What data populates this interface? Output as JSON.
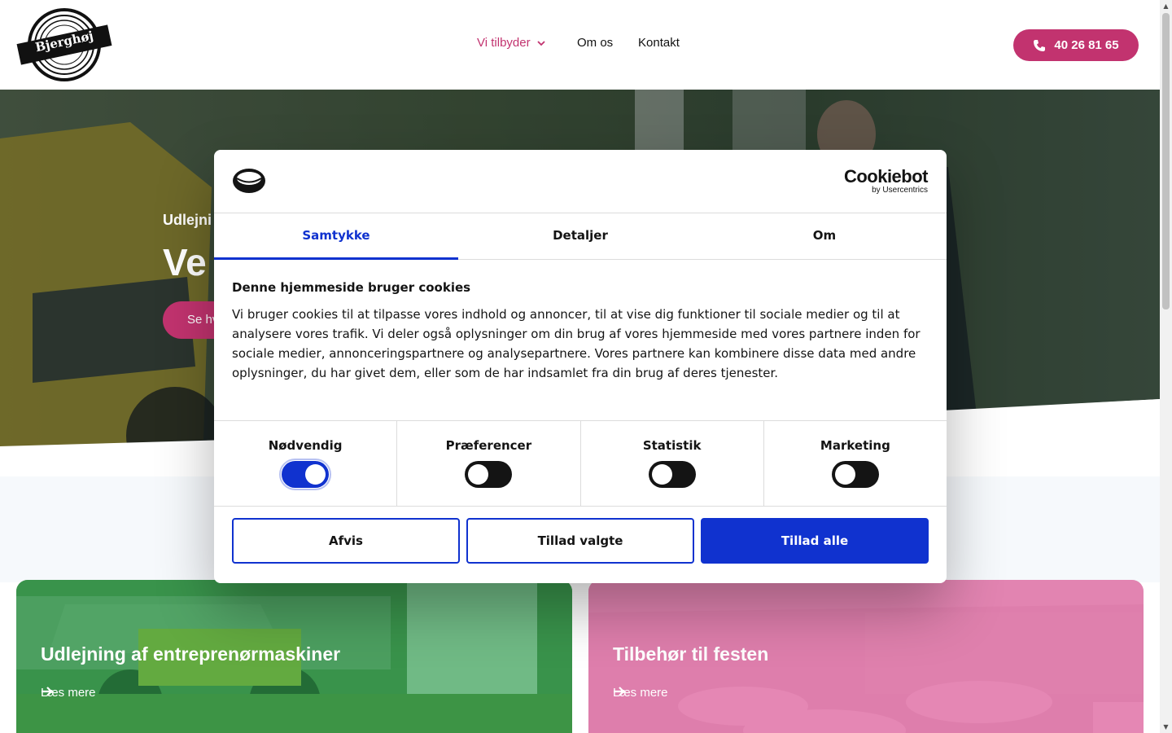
{
  "header": {
    "logo_text": "Bjerghøj",
    "nav": [
      {
        "label": "Vi tilbyder"
      },
      {
        "label": "Om os"
      },
      {
        "label": "Kontakt"
      }
    ],
    "phone": "40 26 81 65"
  },
  "hero": {
    "kicker": "Udlejni",
    "title": "Ve",
    "button": "Se hv"
  },
  "cards": [
    {
      "title": "Udlejning af entreprenørmaskiner",
      "link": "Læs mere"
    },
    {
      "title": "Tilbehør til festen",
      "link": "Læs mere"
    }
  ],
  "cookie_dialog": {
    "brand": "Cookiebot",
    "brand_sub": "by Usercentrics",
    "tabs": [
      "Samtykke",
      "Detaljer",
      "Om"
    ],
    "active_tab": "Samtykke",
    "heading": "Denne hjemmeside bruger cookies",
    "text": "Vi bruger cookies til at tilpasse vores indhold og annoncer, til at vise dig funktioner til sociale medier og til at analysere vores trafik. Vi deler også oplysninger om din brug af vores hjemmeside med vores partnere inden for sociale medier, annonceringspartnere og analysepartnere. Vores partnere kan kombinere disse data med andre oplysninger, du har givet dem, eller som de har indsamlet fra din brug af deres tjenester.",
    "toggles": [
      {
        "label": "Nødvendig",
        "on": true
      },
      {
        "label": "Præferencer",
        "on": false
      },
      {
        "label": "Statistik",
        "on": false
      },
      {
        "label": "Marketing",
        "on": false
      }
    ],
    "buttons": {
      "reject": "Afvis",
      "allow_selected": "Tillad valgte",
      "allow_all": "Tillad alle"
    }
  },
  "colors": {
    "brand_pink": "#c2336f",
    "cookiebot_blue": "#1032cf",
    "card_green": "#2d9b48",
    "card_pink": "#d9468a"
  },
  "icons": [
    "phone-icon",
    "chevron-down-icon",
    "arrow-right-icon",
    "scroll-up-icon",
    "scroll-down-icon"
  ]
}
